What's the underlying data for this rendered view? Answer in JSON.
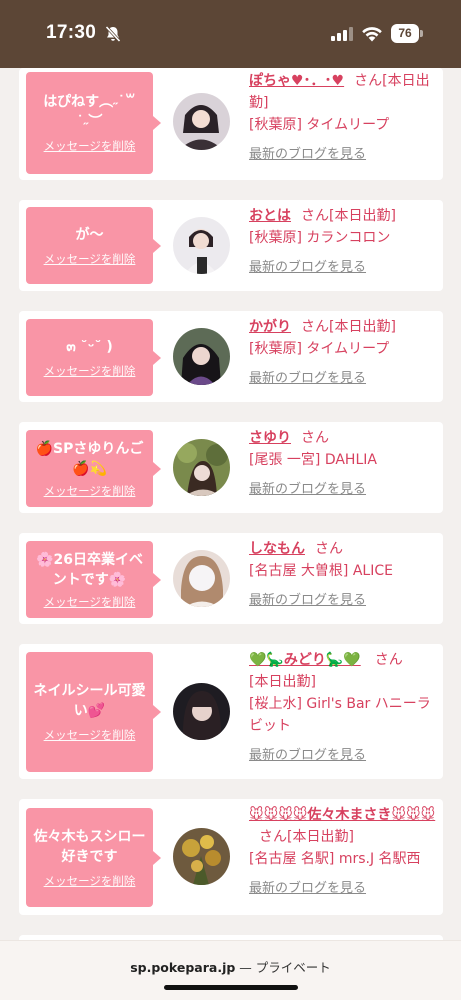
{
  "status_bar": {
    "time": "17:30",
    "battery": "76",
    "icons": [
      "bell-slash-icon",
      "signal-icon",
      "wifi-icon",
      "battery-icon"
    ]
  },
  "delete_label": "メッセージを削除",
  "blog_label": "最新のブログを見る",
  "san_label": "さん",
  "cards": [
    {
      "message": "はぴねす︵˶˙꒳˙˶︶",
      "name": "ぽちゃ♥･．･♥",
      "status": "[本日出勤]",
      "shop": "[秋葉原] タイムリープ"
    },
    {
      "message": "が〜",
      "name": "おとは",
      "status": "[本日出勤]",
      "shop": "[秋葉原] カランコロン"
    },
    {
      "message": "๓ ˘ᵕ˘ )",
      "name": "かがり",
      "status": "[本日出勤]",
      "shop": "[秋葉原] タイムリープ"
    },
    {
      "message": "🍎SPさゆりんご🍎💫",
      "name": "さゆり",
      "status": "",
      "shop": "[尾張 一宮] DAHLIA"
    },
    {
      "message": "🌸26日卒業イベントです🌸",
      "name": "しなもん",
      "status": "",
      "shop": "[名古屋 大曽根] ALICE"
    },
    {
      "message": "ネイルシール可愛い💕",
      "name": "💚🦕みどり🦕💚",
      "status": "[本日出勤]",
      "shop": "[桜上水] Girl's Bar ハニーラビット"
    },
    {
      "message": "佐々木もスシロー好きです",
      "name": "🐭🐭🐭🐭佐々木まさき🐭🐭🐭",
      "status": "[本日出勤]",
      "shop": "[名古屋 名駅] mrs.J 名駅西"
    }
  ],
  "colors": {
    "status_bar": "#5c4636",
    "bubble": "#f995a6",
    "accent_text": "#d7415f",
    "background": "#f3f0ee"
  },
  "browser": {
    "domain": "sp.pokepara.jp",
    "mode": "— プライベート"
  }
}
